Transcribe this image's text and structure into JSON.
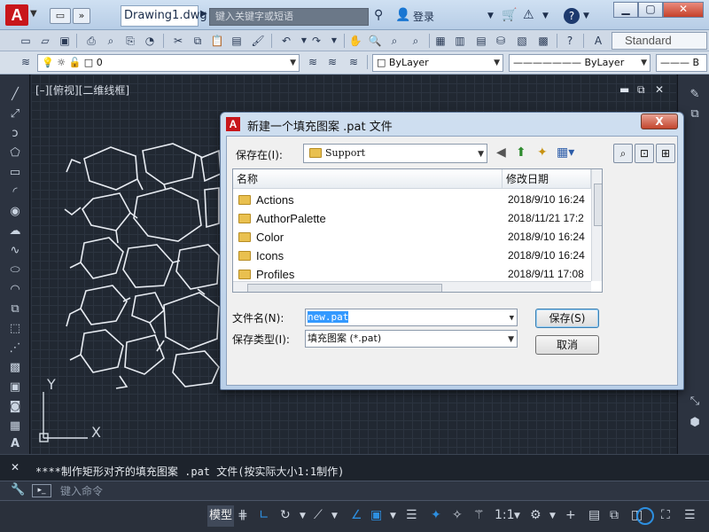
{
  "titlebar": {
    "logo_letter": "A",
    "doc_tab": "Drawing1.dwg",
    "search_placeholder": "键入关键字或短语",
    "login_label": "登录",
    "help_label": "?"
  },
  "toolbar": {
    "text_style": "Standard",
    "layer_value": "0",
    "color_value": "ByLayer",
    "linetype_value": "ByLayer",
    "lineweight_value": "B"
  },
  "viewport": {
    "label": "[–][俯视][二维线框]",
    "axis_x": "X",
    "axis_y": "Y"
  },
  "dialog": {
    "title": "新建一个填充图案 .pat 文件",
    "close_label": "X",
    "save_in_label": "保存在(I):",
    "save_in_value": "Support",
    "columns": [
      "名称",
      "修改日期"
    ],
    "files": [
      {
        "name": "Actions",
        "date": "2018/9/10 16:24"
      },
      {
        "name": "AuthorPalette",
        "date": "2018/11/21 17:2"
      },
      {
        "name": "Color",
        "date": "2018/9/10 16:24"
      },
      {
        "name": "Icons",
        "date": "2018/9/10 16:24"
      },
      {
        "name": "Profiles",
        "date": "2018/9/11 17:08"
      }
    ],
    "filename_label": "文件名(N):",
    "filename_value": "new.pat",
    "filetype_label": "保存类型(I):",
    "filetype_value": "填充图案 (*.pat)",
    "save_button": "保存(S)",
    "cancel_button": "取消"
  },
  "command": {
    "history": "****制作矩形对齐的填充图案 .pat 文件(按实际大小1:1制作)",
    "input_placeholder": "键入命令"
  },
  "statusbar": {
    "model_tab": "模型",
    "scale": "1:1"
  },
  "colors": {
    "canvas_bg": "#212832",
    "accent": "#2d8fe0",
    "app_red": "#c8161b"
  }
}
